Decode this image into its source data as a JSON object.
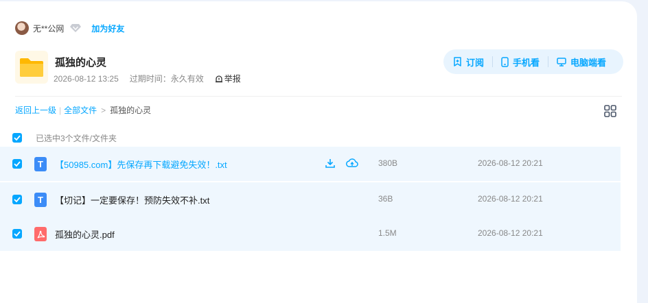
{
  "user": {
    "name": "无**公网",
    "add_friend": "加为好友"
  },
  "share": {
    "title": "孤独的心灵",
    "date": "2026-08-12 13:25",
    "expire": "过期时间：永久有效",
    "report": "举报"
  },
  "actions": {
    "subscribe": "订阅",
    "mobile": "手机看",
    "desktop": "电脑端看"
  },
  "breadcrumb": {
    "back": "返回上一级",
    "all": "全部文件",
    "current": "孤独的心灵"
  },
  "selection": {
    "text": "已选中3个文件/文件夹"
  },
  "files": [
    {
      "name": "【50985.com】先保存再下载避免失效！.txt",
      "size": "380B",
      "time": "2026-08-12 20:21",
      "type": "txt",
      "type_glyph": "T"
    },
    {
      "name": "【切记】一定要保存！预防失效不补.txt",
      "size": "36B",
      "time": "2026-08-12 20:21",
      "type": "txt",
      "type_glyph": "T"
    },
    {
      "name": "孤独的心灵.pdf",
      "size": "1.5M",
      "time": "2026-08-12 20:21",
      "type": "pdf",
      "type_glyph": "pdf"
    }
  ],
  "colors": {
    "accent": "#06a7ff",
    "row_bg": "#eff7fe",
    "folder": "#ffc83d"
  }
}
